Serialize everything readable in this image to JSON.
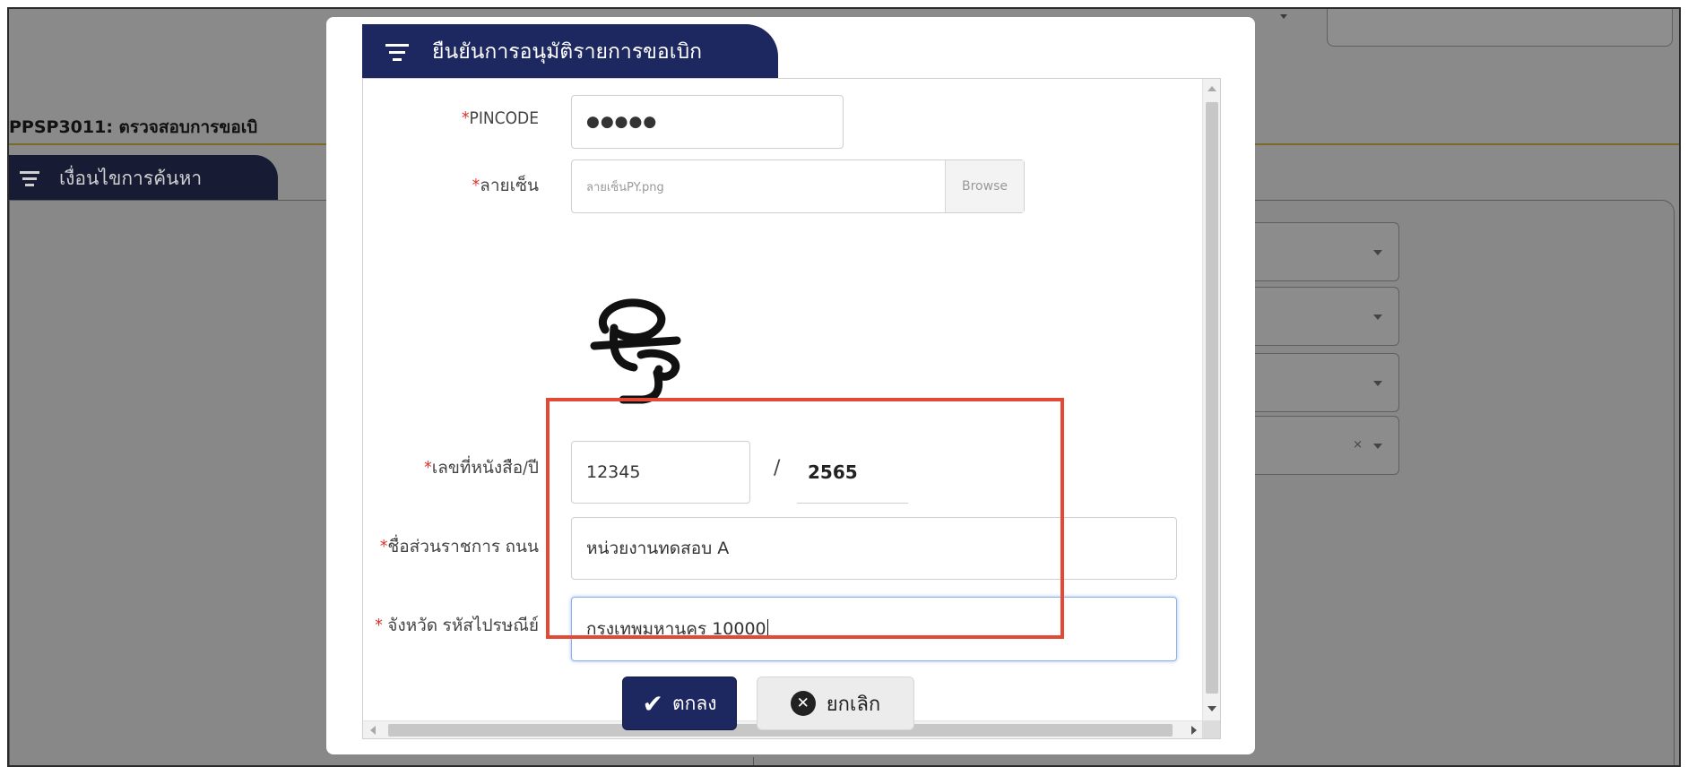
{
  "background": {
    "page_title": "PPSP3011: ตรวจสอบการขอเบิ",
    "search_tab_label": "เงื่อนไขการค้นหา"
  },
  "modal": {
    "title": "ยืนยันการอนุมัติรายการขอเบิก",
    "fields": {
      "pincode": {
        "required_mark": "*",
        "label": "PINCODE",
        "value": "●●●●●"
      },
      "signature": {
        "required_mark": "*",
        "label": "ลายเซ็น",
        "file_name": "ลายเซ็นPY.png",
        "browse_label": "Browse",
        "image_text": "PY"
      },
      "book_number": {
        "required_mark": "*",
        "label": "เลขที่หนังสือ/ปี",
        "number": "12345",
        "separator": "/",
        "year": "2565"
      },
      "agency": {
        "required_mark": "*",
        "label": "ชื่อส่วนราชการ ถนน",
        "value": "หน่วยงานทดสอบ A"
      },
      "province": {
        "required_mark": "* ",
        "label": "จังหวัด รหัสไปรษณีย์",
        "value": "กรุงเทพมหานคร 10000"
      }
    },
    "buttons": {
      "ok_label": "ตกลง",
      "cancel_label": "ยกเลิก"
    }
  },
  "colors": {
    "navy": "#1d2760",
    "required": "#d9322b",
    "highlight": "#e24a35",
    "overlay": "#888888"
  }
}
